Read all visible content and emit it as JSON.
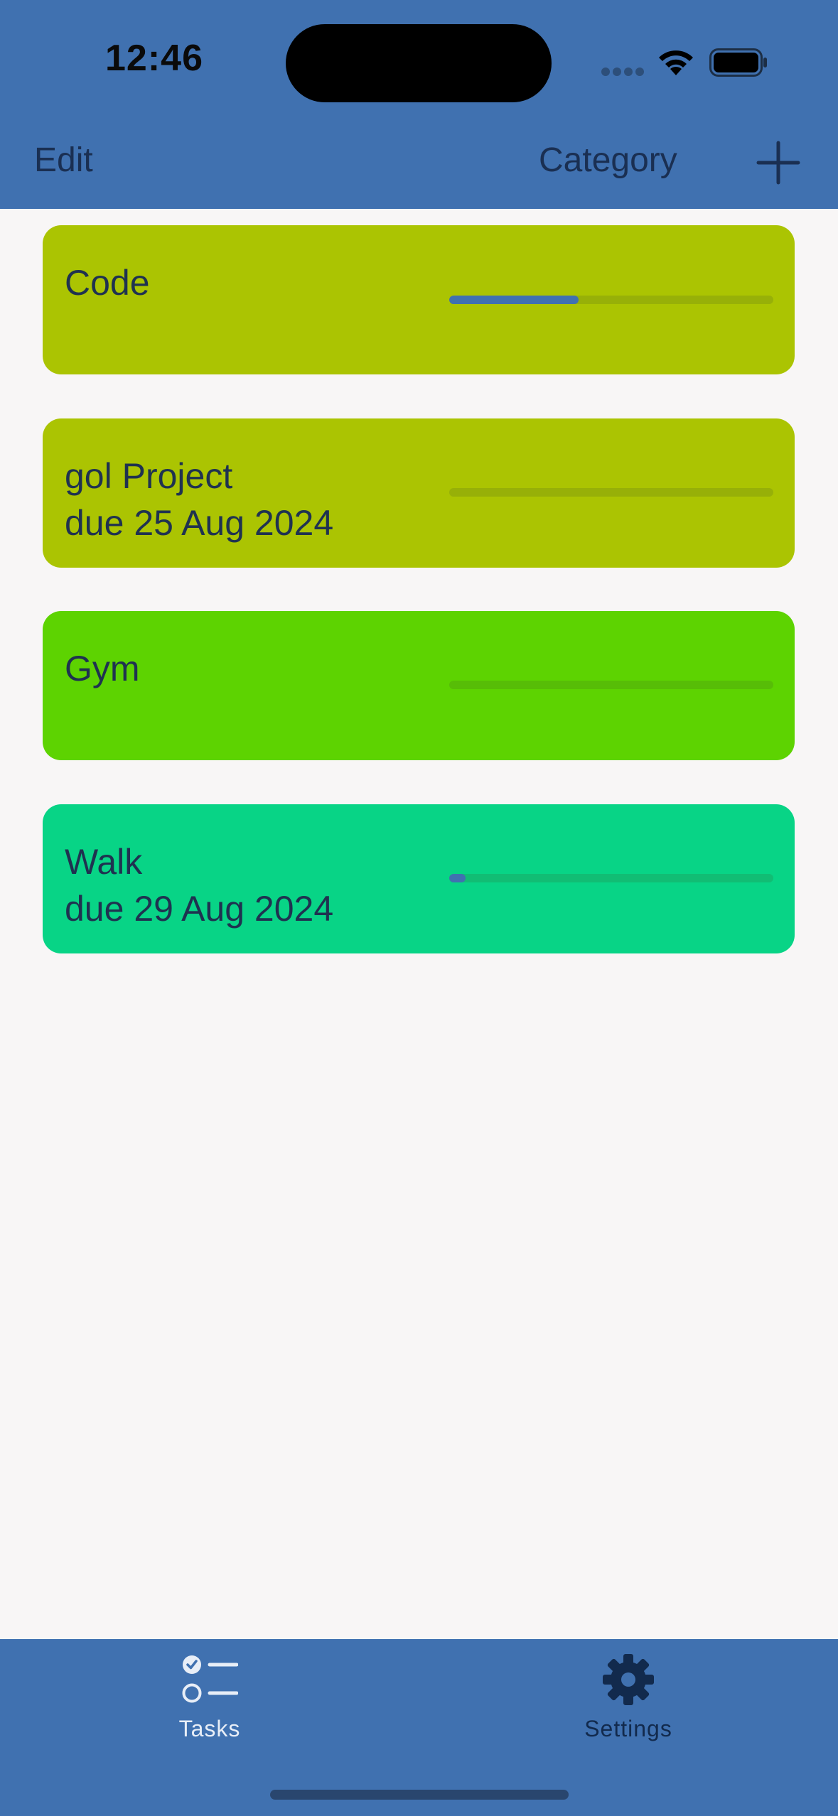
{
  "status_bar": {
    "time": "12:46"
  },
  "nav": {
    "edit_label": "Edit",
    "category_label": "Category",
    "add_icon": "plus-icon"
  },
  "tasks": [
    {
      "title": "Code",
      "due": "",
      "color": "#abc402",
      "progress": 0.4
    },
    {
      "title": "gol Project",
      "due": "due 25 Aug 2024",
      "color": "#abc402",
      "progress": 0.0
    },
    {
      "title": "Gym",
      "due": "",
      "color": "#5dd301",
      "progress": 0.0
    },
    {
      "title": "Walk",
      "due": "due 29 Aug 2024",
      "color": "#08d486",
      "progress": 0.05
    }
  ],
  "tab_bar": {
    "tasks_label": "Tasks",
    "tasks_icon": "checklist-icon",
    "settings_label": "Settings",
    "settings_icon": "gear-icon"
  },
  "colors": {
    "accent": "#4071b0",
    "background": "#f8f6f6"
  }
}
